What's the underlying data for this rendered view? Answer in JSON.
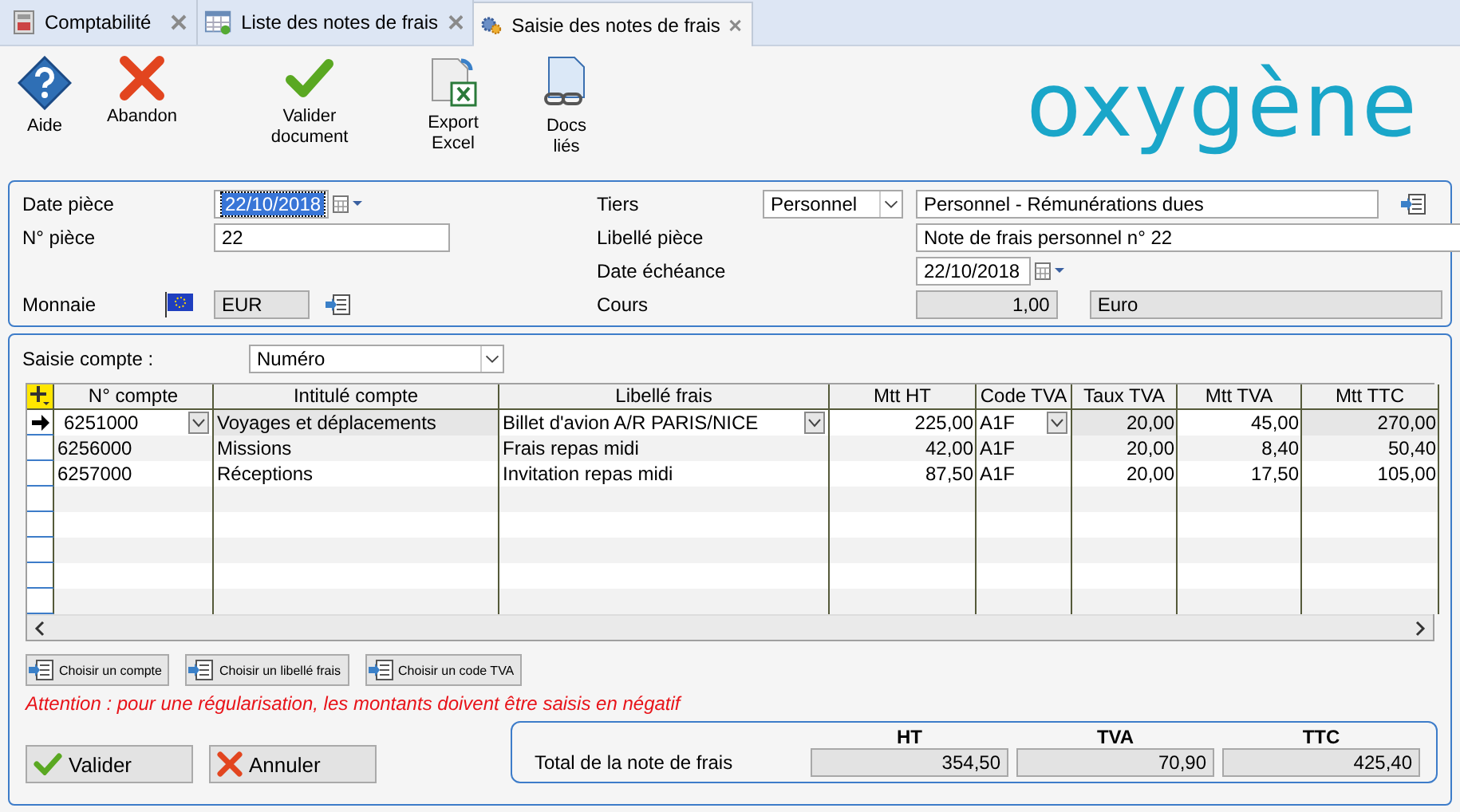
{
  "tabs": [
    {
      "label": "Comptabilité",
      "kind": "ledger",
      "selected": false
    },
    {
      "label": "Liste des notes de frais",
      "kind": "list",
      "selected": false
    },
    {
      "label": "Saisie des notes de frais",
      "kind": "gears",
      "selected": true
    }
  ],
  "toolbar": [
    {
      "label": "Aide",
      "kind": "help"
    },
    {
      "label": "Abandon",
      "kind": "cancel"
    },
    {
      "label": "Valider document",
      "kind": "validate"
    },
    {
      "label": "Export Excel",
      "kind": "export"
    },
    {
      "label": "Docs liés",
      "kind": "docs"
    }
  ],
  "logo": "oxygène",
  "header": {
    "date_piece": {
      "label": "Date pièce",
      "value": "22/10/2018"
    },
    "num_piece": {
      "label": "N° pièce",
      "value": "22"
    },
    "monnaie": {
      "label": "Monnaie",
      "value": "EUR"
    },
    "tiers": {
      "label": "Tiers",
      "type": "Personnel",
      "value": "Personnel - Rémunérations dues"
    },
    "libelle": {
      "label": "Libellé pièce",
      "value": "Note de frais personnel n° 22"
    },
    "echeance": {
      "label": "Date échéance",
      "value": "22/10/2018"
    },
    "cours": {
      "label": "Cours",
      "value": "1,00",
      "currency": "Euro"
    }
  },
  "saisie_compte": {
    "label": "Saisie compte :",
    "value": "Numéro"
  },
  "table": {
    "columns": [
      "N° compte",
      "Intitulé compte",
      "Libellé frais",
      "Mtt HT",
      "Code TVA",
      "Taux TVA",
      "Mtt TVA",
      "Mtt TTC"
    ],
    "rows": [
      {
        "current": true,
        "cells": [
          "6251000",
          "Voyages et déplacements",
          "Billet d'avion A/R PARIS/NICE",
          "225,00",
          "A1F",
          "20,00",
          "45,00",
          "270,00"
        ]
      },
      {
        "current": false,
        "cells": [
          "6256000",
          "Missions",
          "Frais repas midi",
          "42,00",
          "A1F",
          "20,00",
          "8,40",
          "50,40"
        ]
      },
      {
        "current": false,
        "cells": [
          "6257000",
          "Réceptions",
          "Invitation repas midi",
          "87,50",
          "A1F",
          "20,00",
          "17,50",
          "105,00"
        ]
      }
    ]
  },
  "pick_buttons": [
    "Choisir un compte",
    "Choisir un libellé frais",
    "Choisir un code TVA"
  ],
  "warning": "Attention : pour une régularisation, les montants doivent être saisis en négatif",
  "actions": [
    {
      "label": "Valider",
      "kind": "ok"
    },
    {
      "label": "Annuler",
      "kind": "cancel"
    }
  ],
  "totals": {
    "label": "Total de la note de frais",
    "columns": [
      {
        "heading": "HT",
        "value": "354,50"
      },
      {
        "heading": "TVA",
        "value": "70,90"
      },
      {
        "heading": "TTC",
        "value": "425,40"
      }
    ]
  }
}
